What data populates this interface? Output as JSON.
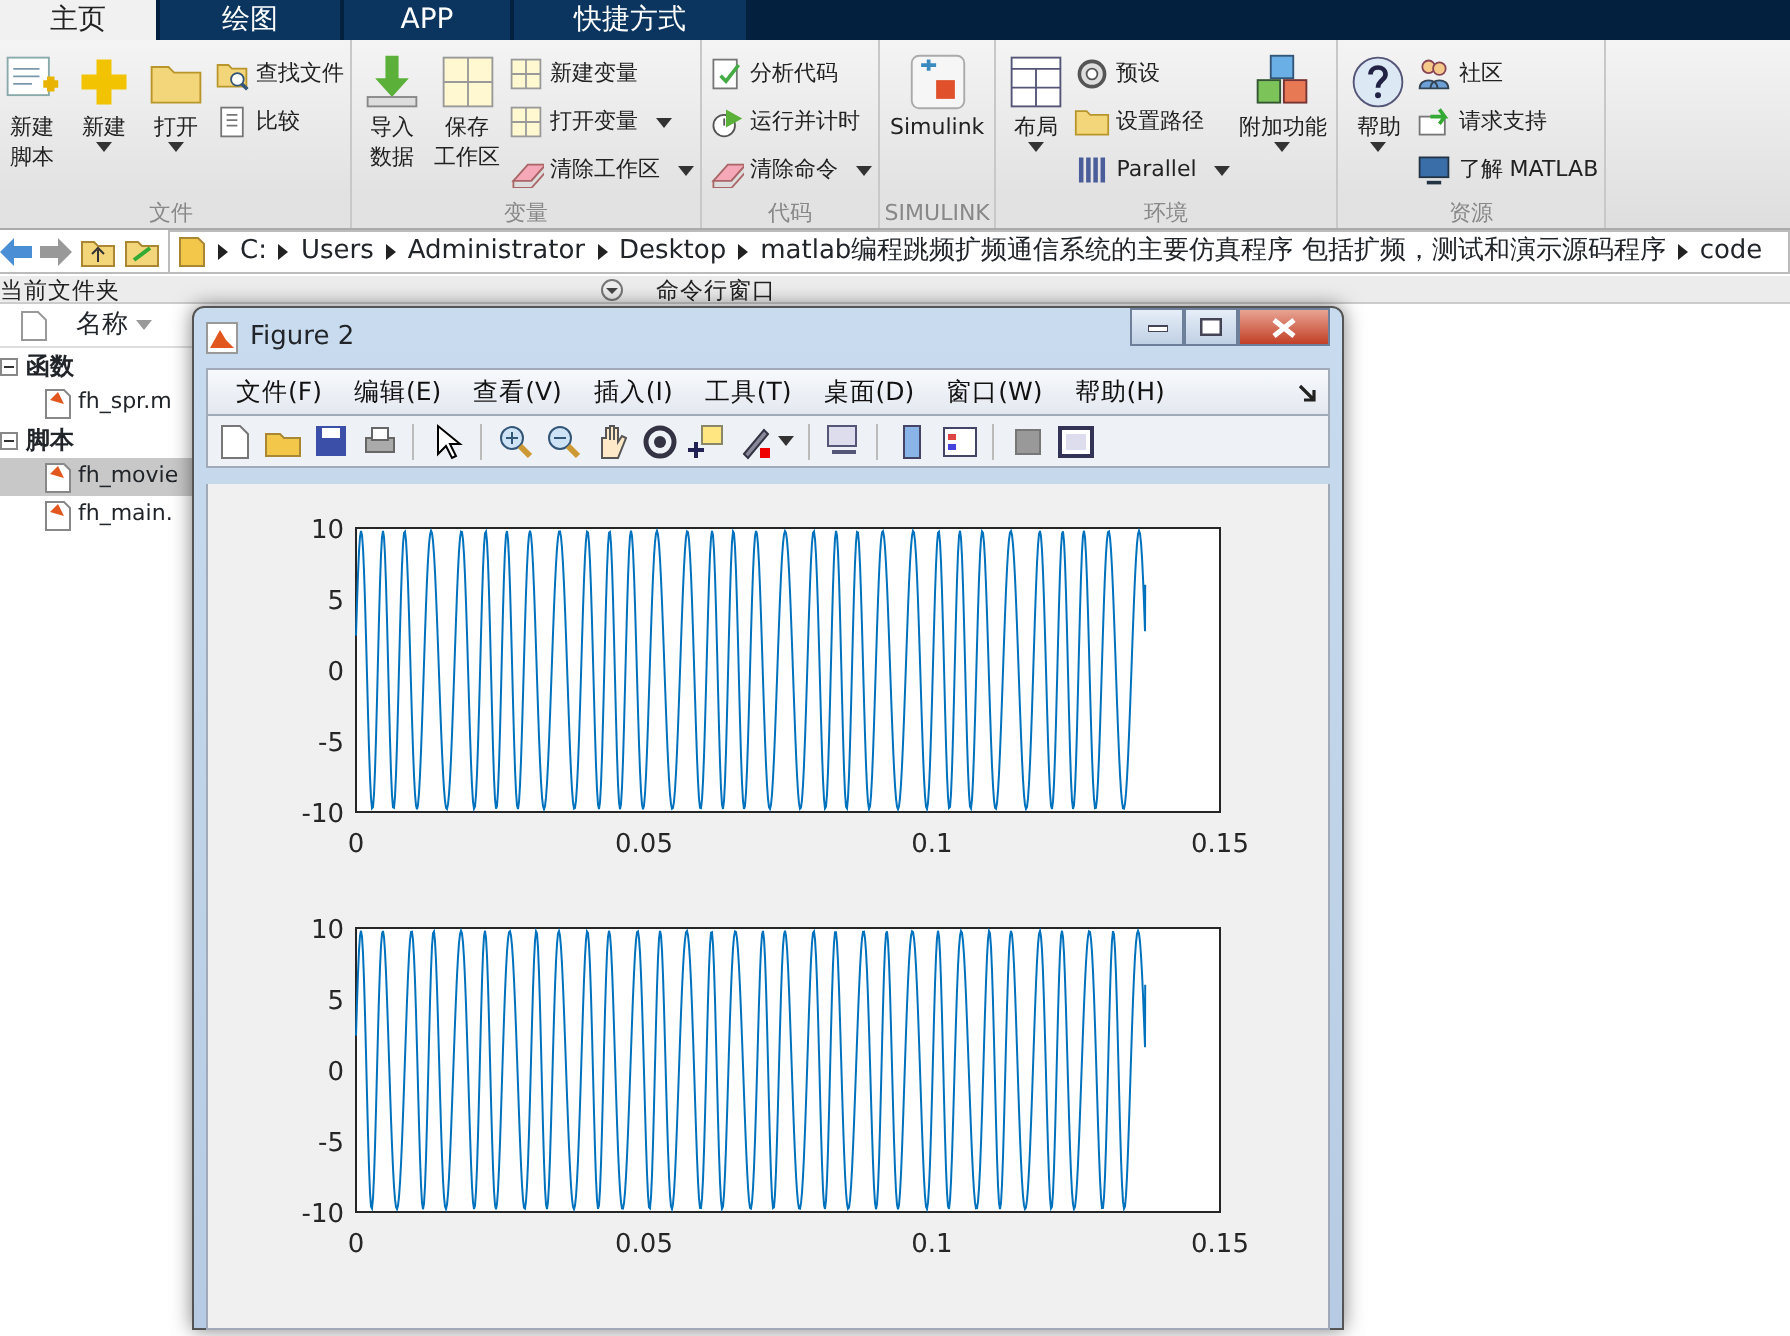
{
  "ribbon_tabs": [
    {
      "label": "主页",
      "selected": true
    },
    {
      "label": "绘图",
      "selected": false
    },
    {
      "label": "APP",
      "selected": false
    },
    {
      "label": "快捷方式",
      "selected": false
    }
  ],
  "ribbon_groups": [
    {
      "label": "文件",
      "large": [
        {
          "label": "新建脚本",
          "two_line": true,
          "menu": false
        },
        {
          "label": "新建",
          "menu": true
        },
        {
          "label": "打开",
          "menu": true
        }
      ],
      "small": [
        {
          "label": "查找文件",
          "menu": false
        },
        {
          "label": "比较",
          "menu": false
        }
      ]
    },
    {
      "label": "变量",
      "large": [
        {
          "label": "导入数据",
          "two_line": true,
          "menu": false
        },
        {
          "label": "保存工作区",
          "two_line": true,
          "menu": false
        }
      ],
      "small": [
        {
          "label": "新建变量",
          "menu": false
        },
        {
          "label": "打开变量",
          "menu": true
        },
        {
          "label": "清除工作区",
          "menu": true
        }
      ]
    },
    {
      "label": "代码",
      "small": [
        {
          "label": "分析代码",
          "menu": false
        },
        {
          "label": "运行并计时",
          "menu": false
        },
        {
          "label": "清除命令",
          "menu": true
        }
      ]
    },
    {
      "label": "SIMULINK",
      "large": [
        {
          "label": "Simulink",
          "menu": false
        }
      ]
    },
    {
      "label": "环境",
      "large": [
        {
          "label": "布局",
          "menu": true
        }
      ],
      "small": [
        {
          "label": "预设",
          "menu": false
        },
        {
          "label": "设置路径",
          "menu": false
        },
        {
          "label": "Parallel",
          "menu": true
        }
      ],
      "large2": [
        {
          "label": "附加功能",
          "menu": true
        }
      ]
    },
    {
      "label": "资源",
      "large": [
        {
          "label": "帮助",
          "menu": true
        }
      ],
      "small": [
        {
          "label": "社区",
          "menu": false
        },
        {
          "label": "请求支持",
          "menu": false
        },
        {
          "label": "了解 MATLAB",
          "menu": false
        }
      ]
    }
  ],
  "address_bar": {
    "segments": [
      "C:",
      "Users",
      "Administrator",
      "Desktop",
      "matlab编程跳频扩频通信系统的主要仿真程序 包括扩频，测试和演示源码程序",
      "code"
    ]
  },
  "current_folder": {
    "title": "当前文件夹",
    "column": "名称",
    "groups": [
      {
        "label": "函数",
        "expanded": true,
        "children": [
          {
            "name": "fh_spr.m",
            "selected": false
          }
        ]
      },
      {
        "label": "脚本",
        "expanded": true,
        "children": [
          {
            "name": "fh_movie",
            "selected": true
          },
          {
            "name": "fh_main.",
            "selected": false
          }
        ]
      }
    ]
  },
  "command_window": {
    "title": "命令行窗口"
  },
  "figure_window": {
    "title": "Figure 2",
    "menu": [
      "文件(F)",
      "编辑(E)",
      "查看(V)",
      "插入(I)",
      "工具(T)",
      "桌面(D)",
      "窗口(W)",
      "帮助(H)"
    ],
    "axes": [
      {
        "xticks": [
          "0",
          "0.05",
          "0.1",
          "0.15"
        ],
        "yticks": [
          "10",
          "5",
          "0",
          "-5",
          "-10"
        ]
      },
      {
        "xticks": [
          "0",
          "0.05",
          "0.1",
          "0.15"
        ],
        "yticks": [
          "10",
          "5",
          "0",
          "-5",
          "-10"
        ]
      }
    ]
  }
}
